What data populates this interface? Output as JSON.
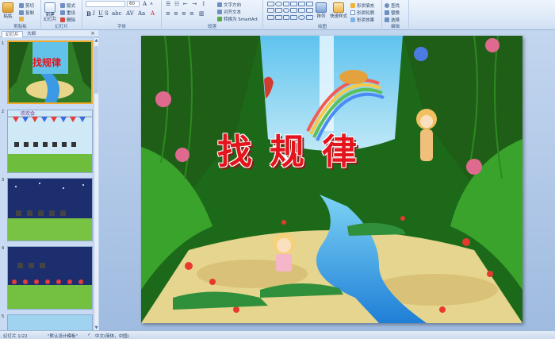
{
  "ribbon": {
    "groups": {
      "clipboard": "剪贴板",
      "slides": "幻灯片",
      "font": "字体",
      "paragraph": "段落",
      "drawing": "绘图",
      "editing": "编辑"
    },
    "paste_label": "粘贴",
    "cut_label": "剪切",
    "copy_label": "复制",
    "new_slide_label": "新建\n幻灯片",
    "layout_label": "版式",
    "reset_label": "重设",
    "delete_label": "删除",
    "font_size_value": "60",
    "text_direction_label": "文字方向",
    "align_text_label": "对齐文本",
    "smartart_label": "转换为 SmartArt",
    "arrange_label": "排列",
    "quick_styles_label": "快速样式",
    "shape_fill_label": "形状填充",
    "shape_outline_label": "形状轮廓",
    "shape_effects_label": "形状效果",
    "find_label": "查找",
    "replace_label": "替换",
    "select_label": "选择"
  },
  "left_pane": {
    "tab_slides": "幻灯片",
    "tab_outline": "大纲",
    "close_symbol": "×",
    "thumbs": [
      {
        "num": "1"
      },
      {
        "num": "2",
        "caption": "欢欢会"
      },
      {
        "num": "3"
      },
      {
        "num": "4"
      },
      {
        "num": "5"
      }
    ]
  },
  "slide": {
    "title": "找规律"
  },
  "status": {
    "slide_counter": "幻灯片 1/22",
    "theme": "\"默认设计模板\"",
    "language": "中文(简体，中国)"
  },
  "colors": {
    "ribbon_bg": "#dbe7f7",
    "title_red": "#e4141c",
    "selected_thumb_border": "#f0a92b"
  }
}
